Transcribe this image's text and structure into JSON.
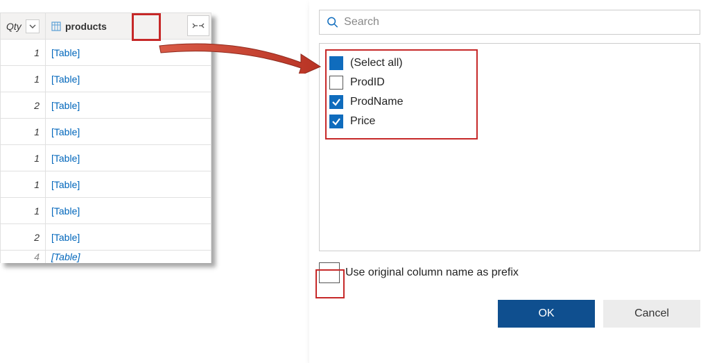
{
  "table": {
    "columns": {
      "qty_header": "Qty",
      "products_header": "products"
    },
    "rows": [
      {
        "qty": "1",
        "products": "[Table]"
      },
      {
        "qty": "1",
        "products": "[Table]"
      },
      {
        "qty": "2",
        "products": "[Table]"
      },
      {
        "qty": "1",
        "products": "[Table]"
      },
      {
        "qty": "1",
        "products": "[Table]"
      },
      {
        "qty": "1",
        "products": "[Table]"
      },
      {
        "qty": "1",
        "products": "[Table]"
      },
      {
        "qty": "2",
        "products": "[Table]"
      },
      {
        "qty": "4",
        "products": "[Table]"
      }
    ]
  },
  "dialog": {
    "search_placeholder": "Search",
    "columns": [
      {
        "label": "(Select all)",
        "state": "solid"
      },
      {
        "label": "ProdID",
        "state": "unchecked"
      },
      {
        "label": "ProdName",
        "state": "checked"
      },
      {
        "label": "Price",
        "state": "checked"
      }
    ],
    "prefix_label": "Use original column name as prefix",
    "prefix_checked": false,
    "ok_label": "OK",
    "cancel_label": "Cancel"
  }
}
